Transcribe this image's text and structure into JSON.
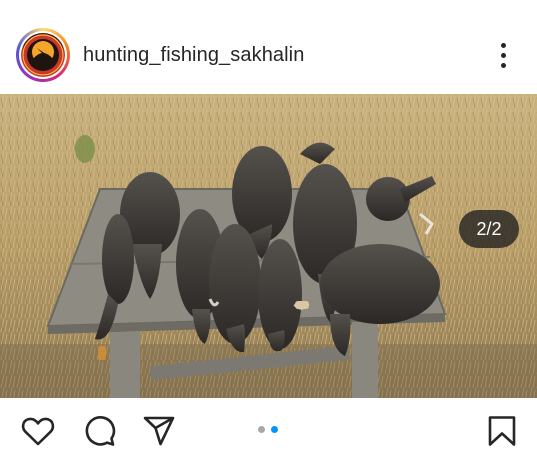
{
  "post": {
    "username": "hunting_fishing_sakhalin",
    "avatar_icon": "hunting-logo-icon",
    "more_icon": "more-vertical-icon",
    "media_counter": "2/2",
    "carousel_active_index": 2,
    "carousel_total": 2
  },
  "actions": {
    "like_icon": "heart-icon",
    "comment_icon": "comment-icon",
    "share_icon": "share-icon",
    "save_icon": "bookmark-icon"
  },
  "colors": {
    "text": "#262626",
    "dot_active": "#0095f6",
    "dot_inactive": "#a8a8a8"
  }
}
